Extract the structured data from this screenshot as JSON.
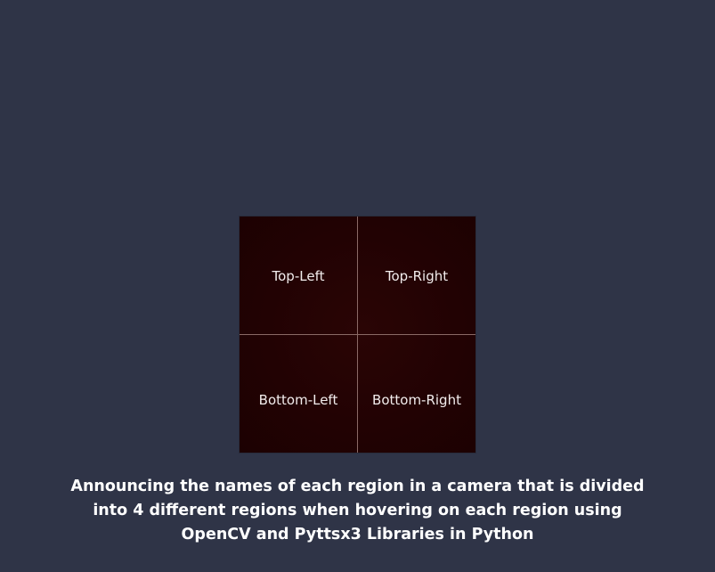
{
  "camera": {
    "regions": [
      {
        "label": "Top-Left"
      },
      {
        "label": "Top-Right"
      },
      {
        "label": "Bottom-Left"
      },
      {
        "label": "Bottom-Right"
      }
    ]
  },
  "caption": {
    "line1": "Announcing the names of each region in a camera that is divided",
    "line2": "into 4 different regions when hovering on each region using",
    "line3": "OpenCV and Pyttsx3 Libraries in Python"
  },
  "colors": {
    "background": "#2f3447",
    "camera_feed": "#220203",
    "grid_lines": "#8a6a66",
    "label_text": "#f2eded",
    "caption_text": "#ffffff"
  }
}
